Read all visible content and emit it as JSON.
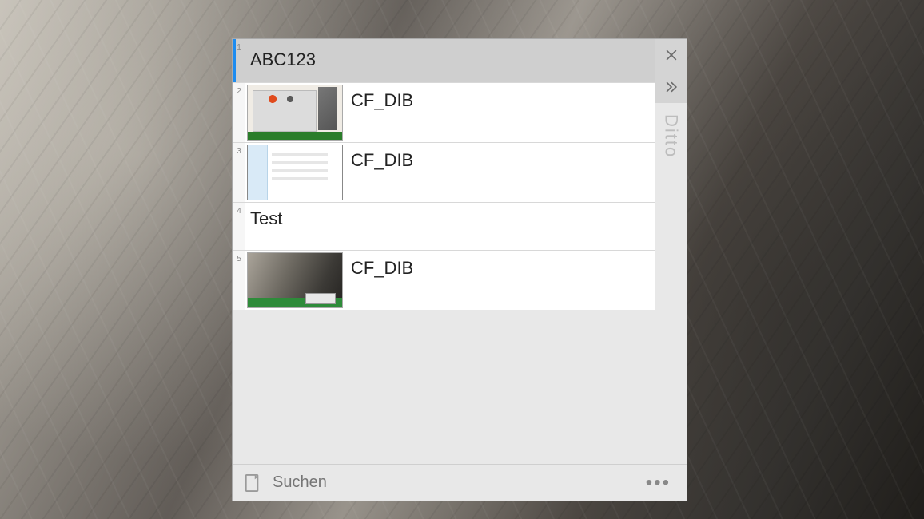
{
  "app": {
    "title": "Ditto"
  },
  "items": [
    {
      "index": "1",
      "label": "ABC123",
      "type": "text",
      "selected": true
    },
    {
      "index": "2",
      "label": "CF_DIB",
      "type": "image",
      "thumb": "desktop"
    },
    {
      "index": "3",
      "label": "CF_DIB",
      "type": "image",
      "thumb": "lightwin"
    },
    {
      "index": "4",
      "label": "Test",
      "type": "text"
    },
    {
      "index": "5",
      "label": "CF_DIB",
      "type": "image",
      "thumb": "rock"
    }
  ],
  "search": {
    "placeholder": "Suchen"
  },
  "icons": {
    "close": "close-icon",
    "expand": "chevrons-right-icon",
    "more": "more-icon",
    "paste": "paste-icon"
  }
}
